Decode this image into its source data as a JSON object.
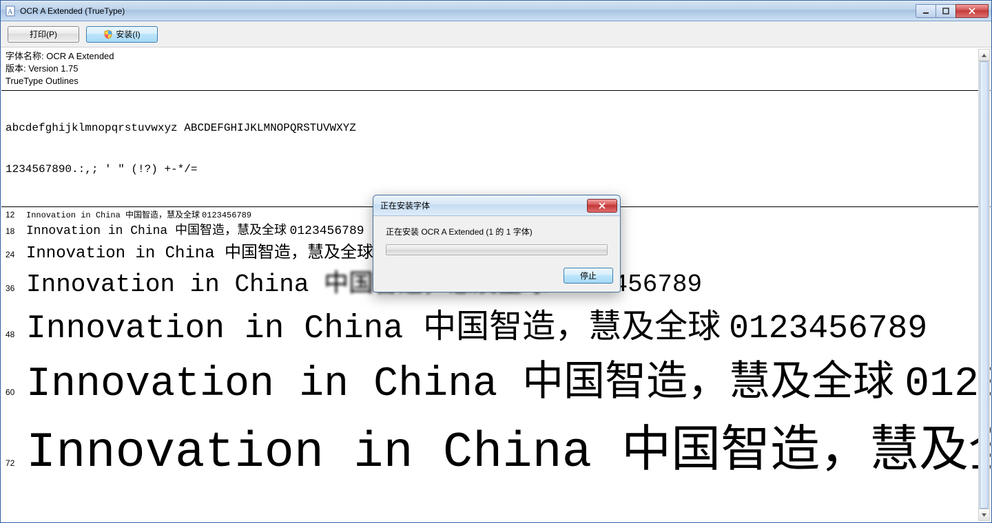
{
  "window": {
    "title": "OCR A Extended (TrueType)"
  },
  "toolbar": {
    "print_label": "打印(P)",
    "install_label": "安装(I)"
  },
  "meta": {
    "font_name_label": "字体名称: OCR A Extended",
    "version_label": "版本: Version 1.75",
    "outlines_label": "TrueType Outlines"
  },
  "glyphs": {
    "line1": "abcdefghijklmnopqrstuvwxyz ABCDEFGHIJKLMNOPQRSTUVWXYZ",
    "line2": "1234567890.:,; ' \" (!?) +-*/="
  },
  "sample_text_latin": "Innovation in China ",
  "sample_text_cjk": "中国智造，慧及全球 ",
  "sample_text_digits": "0123456789",
  "sample_sizes": [
    "12",
    "18",
    "24",
    "36",
    "48",
    "60",
    "72"
  ],
  "dialog": {
    "title": "正在安装字体",
    "message": "正在安装 OCR A Extended (1 的 1 字体)",
    "stop_label": "停止"
  }
}
